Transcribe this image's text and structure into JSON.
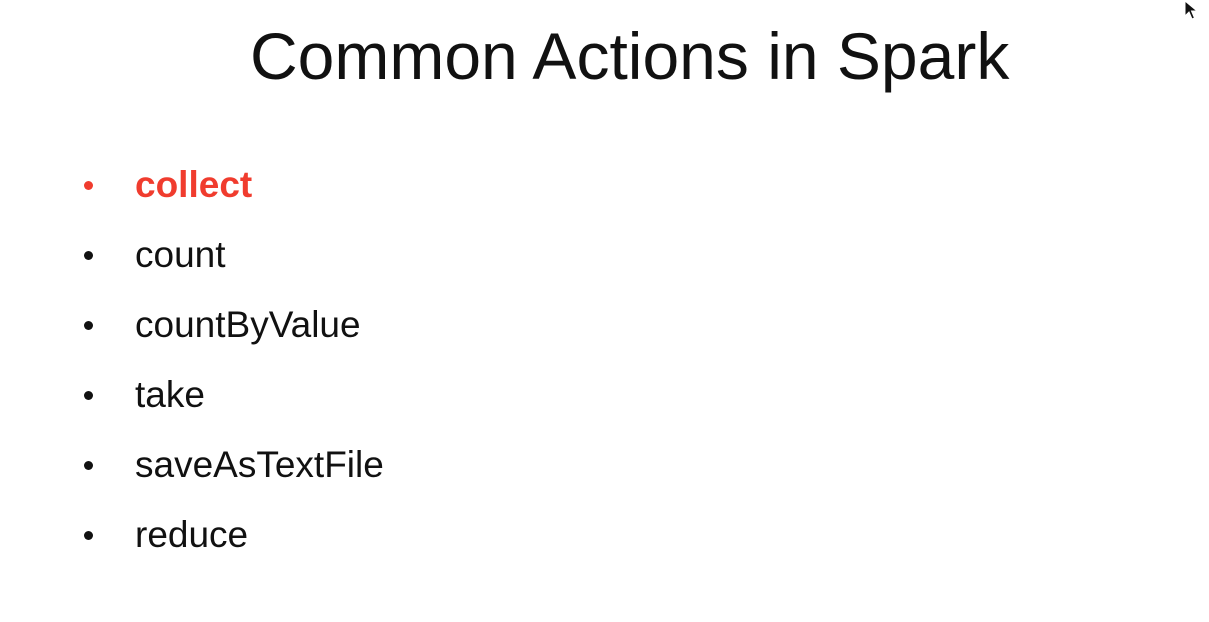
{
  "slide": {
    "title": "Common Actions in Spark",
    "accent_color": "#f03c2e",
    "items": [
      {
        "label": "collect",
        "highlighted": true
      },
      {
        "label": "count",
        "highlighted": false
      },
      {
        "label": "countByValue",
        "highlighted": false
      },
      {
        "label": "take",
        "highlighted": false
      },
      {
        "label": "saveAsTextFile",
        "highlighted": false
      },
      {
        "label": "reduce",
        "highlighted": false
      }
    ]
  },
  "cursor": {
    "icon": "mouse-pointer-icon"
  }
}
